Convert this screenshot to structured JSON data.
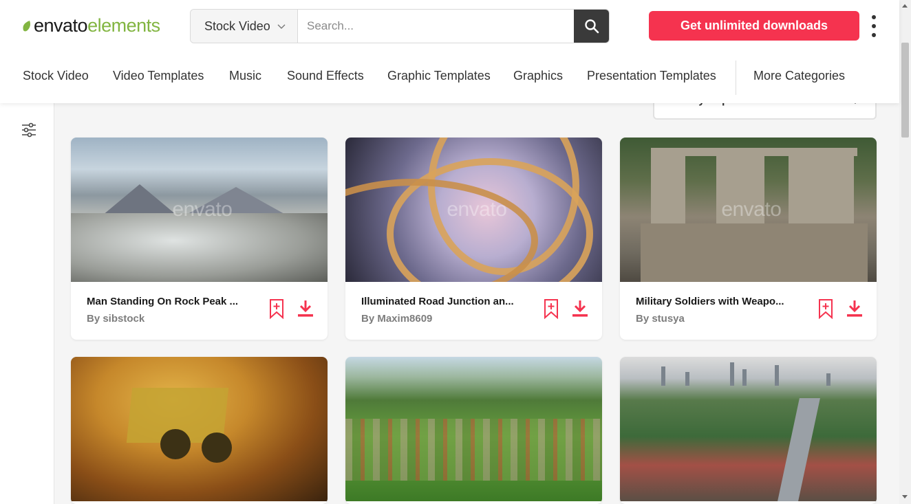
{
  "header": {
    "logo_word1": "envato",
    "logo_word2": "elements",
    "search_category": "Stock Video",
    "search_placeholder": "Search...",
    "cta_label": "Get unlimited downloads"
  },
  "categories": [
    {
      "label": "Stock Video"
    },
    {
      "label": "Video Templates"
    },
    {
      "label": "Music"
    },
    {
      "label": "Sound Effects"
    },
    {
      "label": "Graphic Templates"
    },
    {
      "label": "Graphics"
    },
    {
      "label": "Presentation Templates"
    },
    {
      "label": "More Categories"
    }
  ],
  "sort": {
    "label": "Sort by Popular"
  },
  "watermark": "envato",
  "items": [
    {
      "title": "Man Standing On Rock Peak ...",
      "author": "By sibstock"
    },
    {
      "title": "Illuminated Road Junction an...",
      "author": "By Maxim8609"
    },
    {
      "title": "Military Soldiers with Weapo...",
      "author": "By stusya"
    }
  ],
  "colors": {
    "accent": "#f5334f",
    "brand_green": "#82b541",
    "search_button": "#3a3a3a"
  }
}
